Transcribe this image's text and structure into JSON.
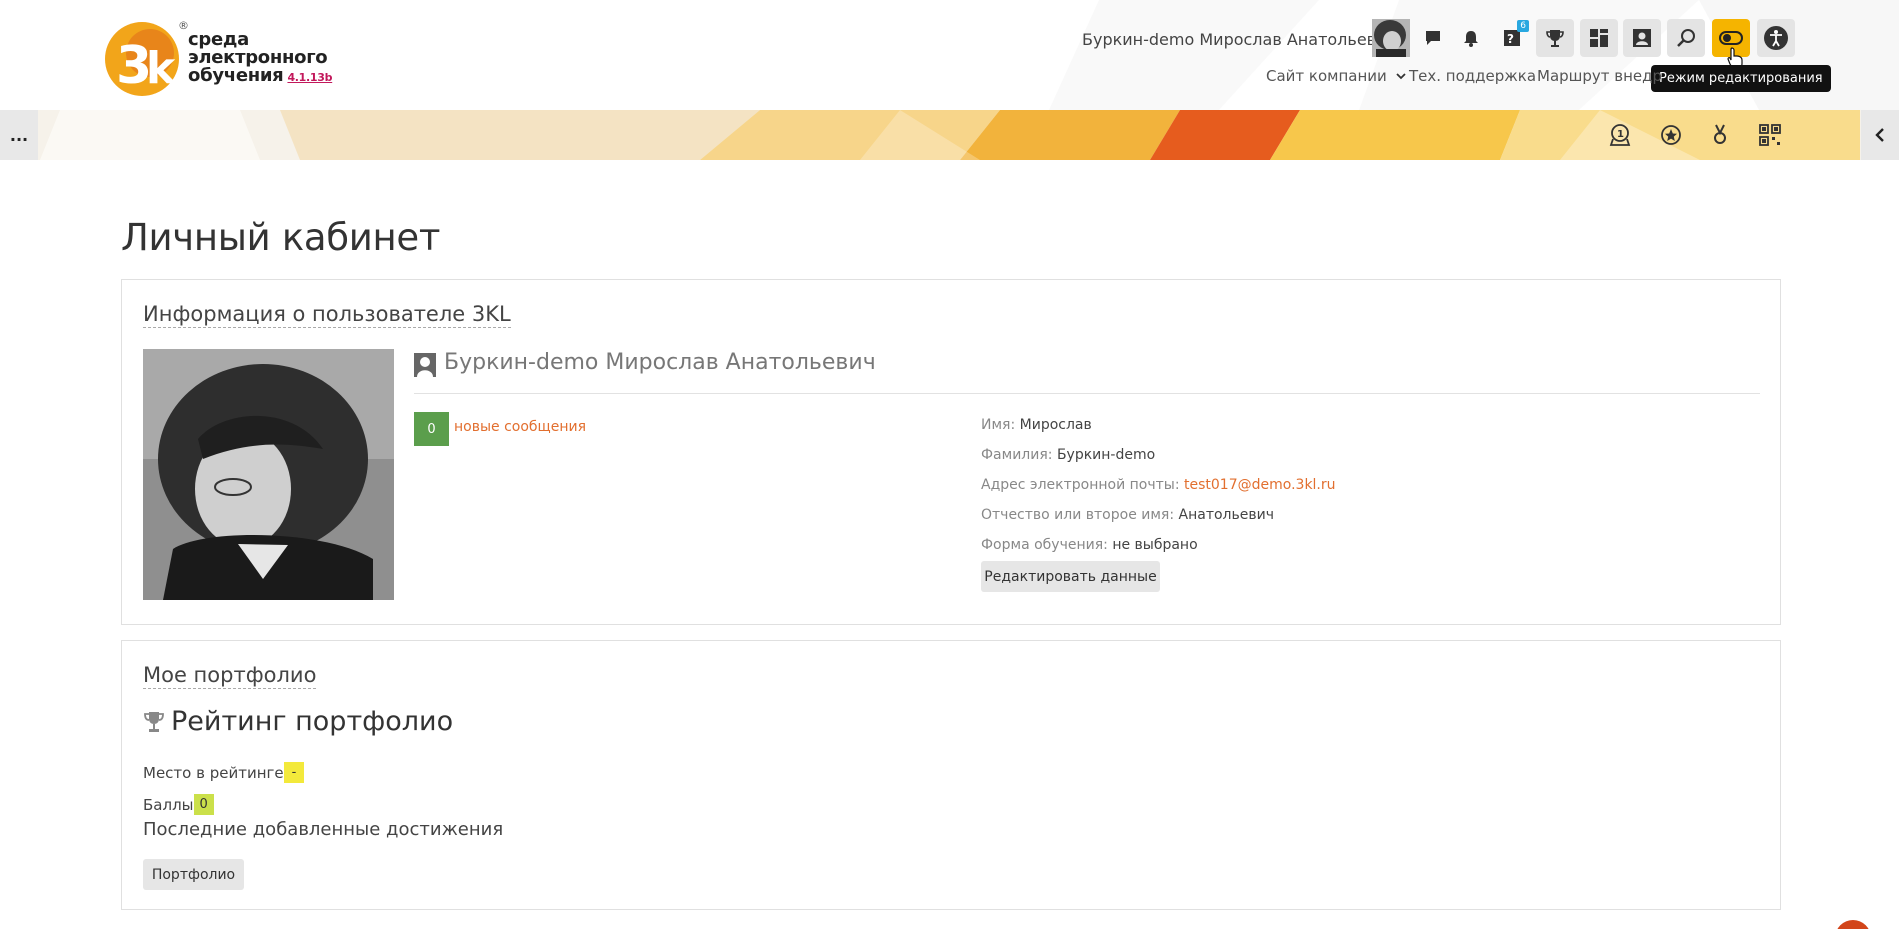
{
  "header": {
    "logo": {
      "lines": [
        "среда",
        "электронного",
        "обучения"
      ],
      "version": "4.1.13b",
      "reg_mark": "®"
    },
    "user_name": "Буркин-demo Мирослав Анатольевич",
    "icons": [
      "chat-icon",
      "bell-icon",
      "help-icon",
      "trophy-icon",
      "dashboard-icon",
      "profile-card-icon",
      "search-icon",
      "edit-mode-toggle-icon",
      "accessibility-icon"
    ],
    "help_badge": "6",
    "tooltip": "Режим редактирования",
    "nav": {
      "company_site": "Сайт компании",
      "support": "Тех. поддержка",
      "route": "Маршрут внедр"
    }
  },
  "banner": {
    "left_button": "...",
    "icons": [
      "leaderboard-icon",
      "star-badge-icon",
      "medal-icon",
      "qr-icon"
    ],
    "right_icon": "chevron-left-icon"
  },
  "main": {
    "page_title": "Личный кабинет",
    "user_info": {
      "title": "Информация о пользователе 3KL",
      "full_name": "Буркин-demo Мирослав Анатольевич",
      "message_count": "0",
      "messages_link": "новые сообщения",
      "fields": [
        {
          "label": "Имя:",
          "value": "Мирослав"
        },
        {
          "label": "Фамилия:",
          "value": "Буркин-demo"
        },
        {
          "label": "Адрес электронной почты:",
          "value": "test017@demo.3kl.ru"
        },
        {
          "label": "Отчество или второе имя:",
          "value": "Анатольевич"
        },
        {
          "label": "Форма обучения:",
          "value": "не выбрано"
        }
      ],
      "edit_button": "Редактировать данные"
    },
    "portfolio": {
      "title": "Мое портфолио",
      "rating_title": "Рейтинг портфолио",
      "place_label": "Место в рейтинге",
      "place_value": "-",
      "points_label": "Баллы",
      "points_value": "0",
      "recent_achievements": "Последние добавленные достижения",
      "portfolio_button": "Портфолио"
    }
  },
  "colors": {
    "accent": "#f5b400",
    "link": "#e26f2f",
    "message_badge": "#5b9e4c",
    "highlight_yellow": "#f3e93b",
    "highlight_green": "#cbe04a"
  }
}
